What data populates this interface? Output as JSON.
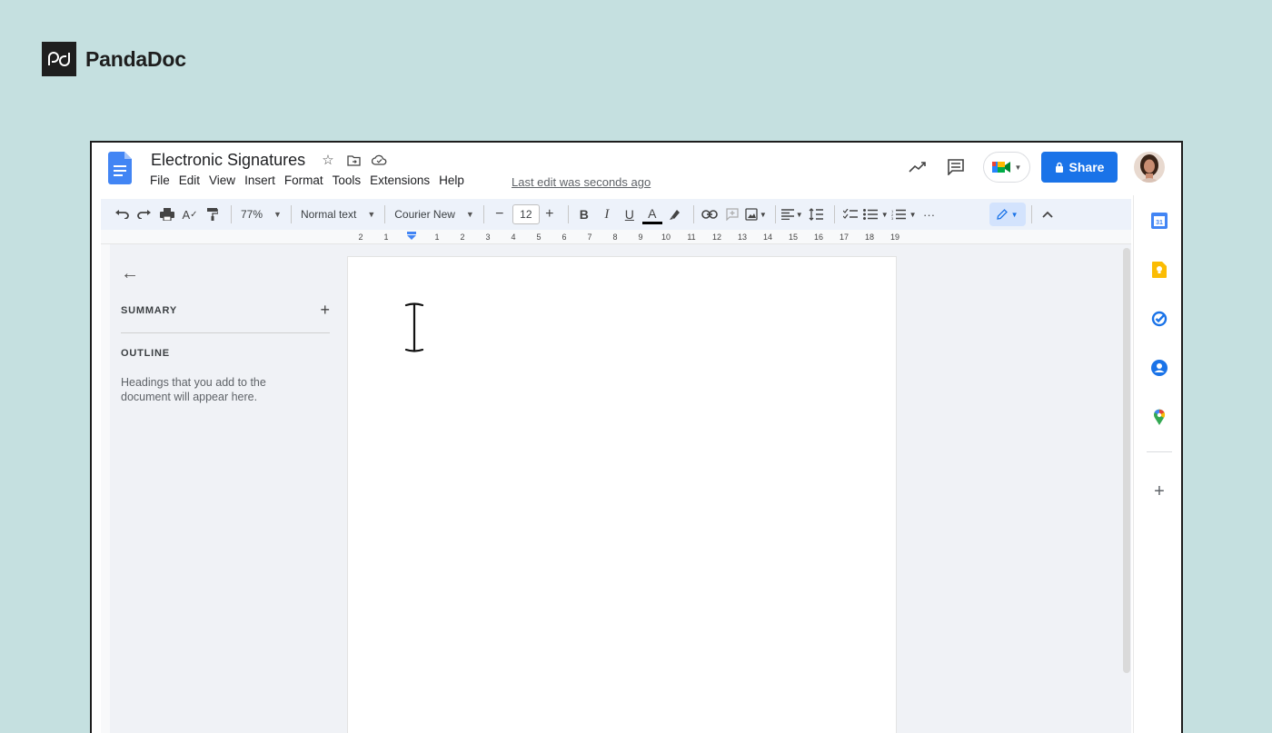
{
  "brand": {
    "name": "PandaDoc"
  },
  "doc": {
    "title": "Electronic Signatures",
    "menu": [
      "File",
      "Edit",
      "View",
      "Insert",
      "Format",
      "Tools",
      "Extensions",
      "Help"
    ],
    "last_edit": "Last edit was seconds ago"
  },
  "header": {
    "share_label": "Share"
  },
  "toolbar": {
    "zoom": "77%",
    "style": "Normal text",
    "font": "Courier New",
    "font_size": "12",
    "more": "···"
  },
  "ruler": {
    "labels": [
      "2",
      "1",
      "",
      "1",
      "2",
      "3",
      "4",
      "5",
      "6",
      "7",
      "8",
      "9",
      "10",
      "11",
      "12",
      "13",
      "14",
      "15",
      "16",
      "17",
      "18",
      "19"
    ]
  },
  "outline_panel": {
    "summary_label": "SUMMARY",
    "outline_label": "OUTLINE",
    "hint": "Headings that you add to the document will appear here."
  },
  "colors": {
    "background": "#c5e0e0",
    "share_button": "#1a73e8",
    "toolbar": "#edf2fa"
  },
  "icons": {
    "side_panel": [
      "calendar-icon",
      "keep-icon",
      "tasks-icon",
      "contacts-icon",
      "maps-icon",
      "add-icon"
    ]
  }
}
